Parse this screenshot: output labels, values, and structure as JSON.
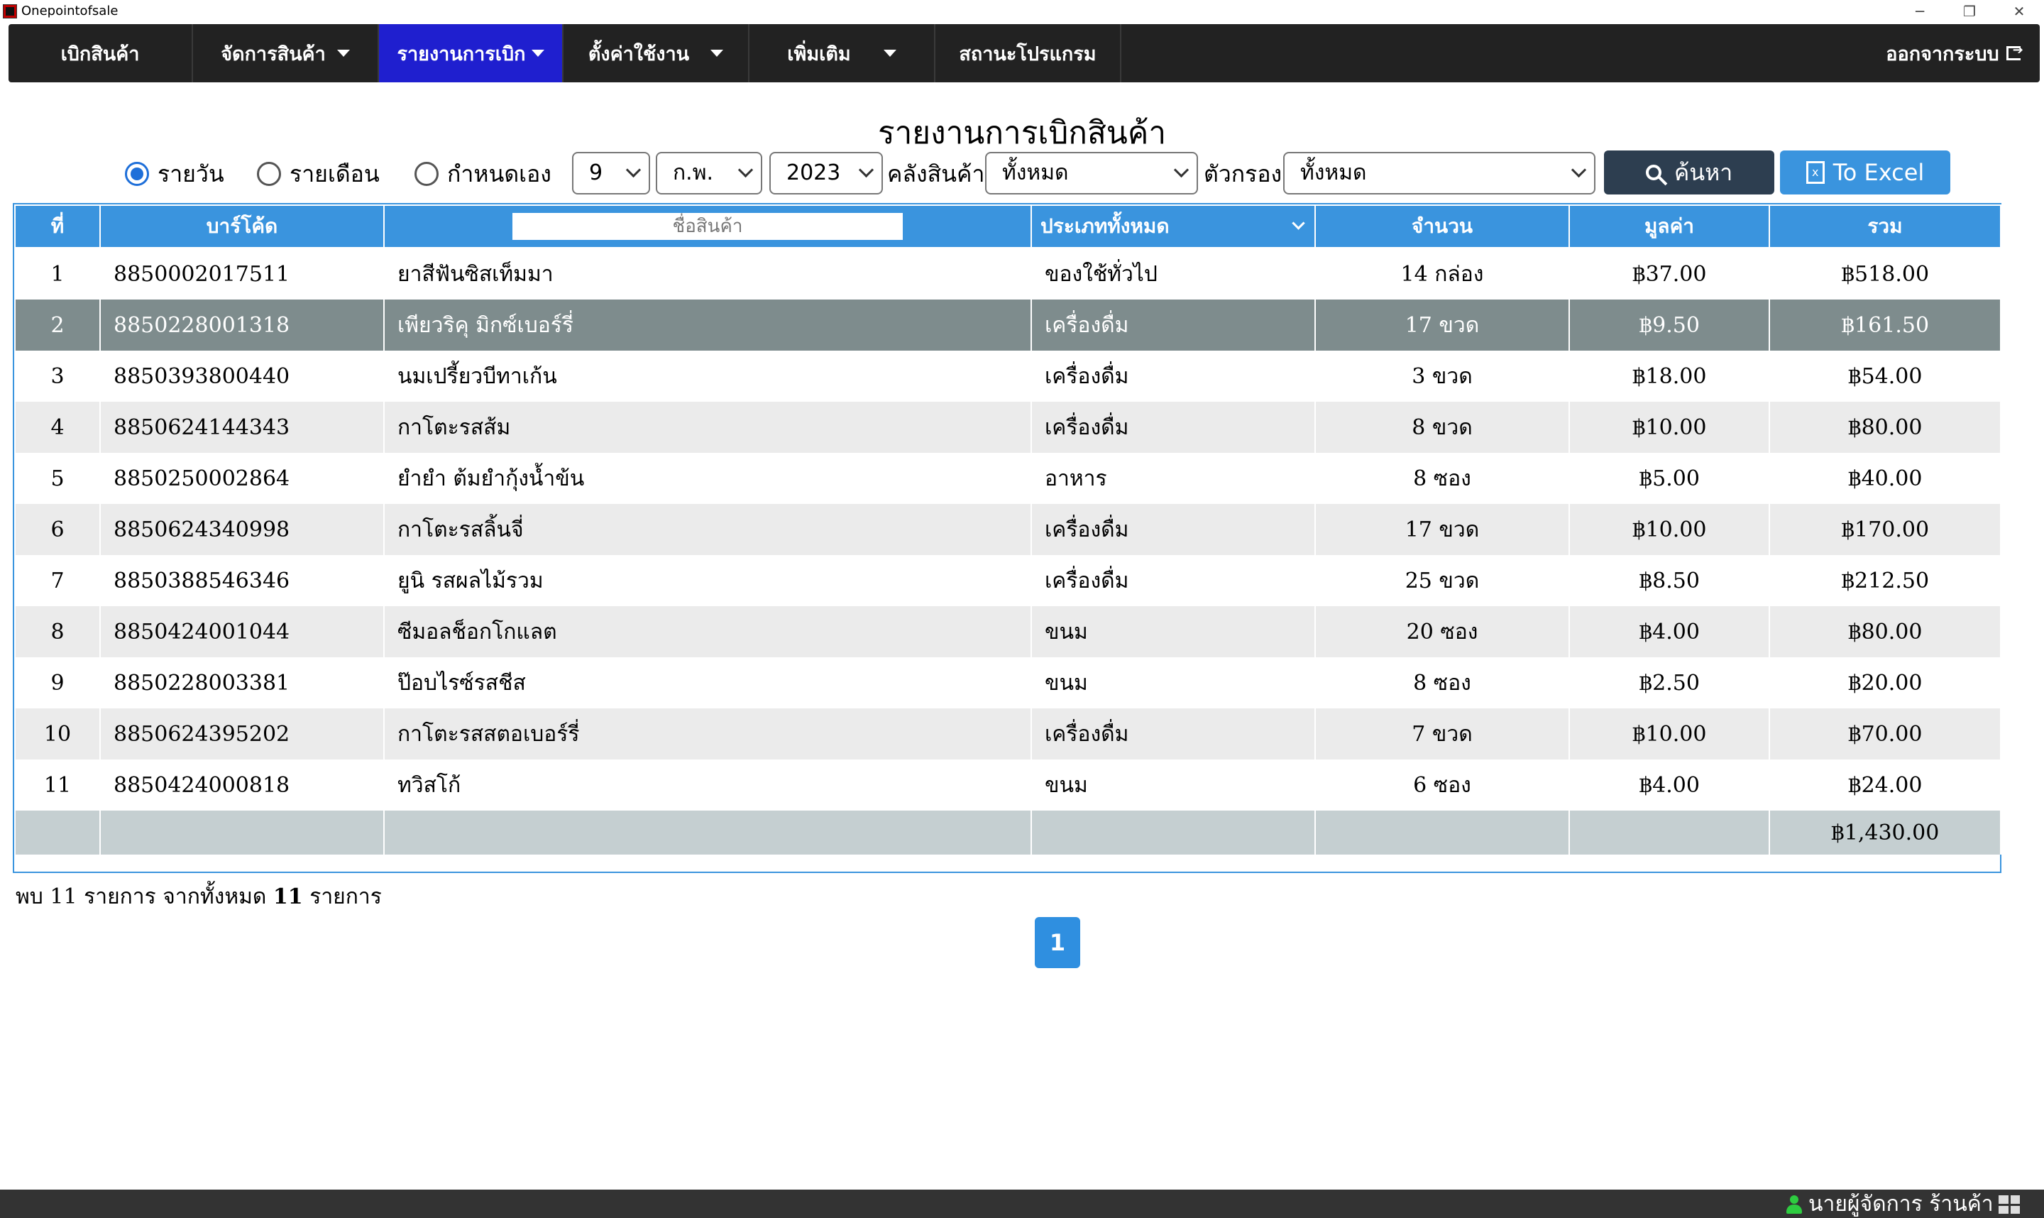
{
  "window": {
    "title": "Onepointofsale"
  },
  "nav": {
    "items": [
      {
        "label": "เบิกสินค้า",
        "dropdown": false,
        "active": false
      },
      {
        "label": "จัดการสินค้า",
        "dropdown": true,
        "active": false
      },
      {
        "label": "รายงานการเบิก",
        "dropdown": true,
        "active": true
      },
      {
        "label": "ตั้งค่าใช้งาน",
        "dropdown": true,
        "active": false
      },
      {
        "label": "เพิ่มเติม",
        "dropdown": true,
        "active": false
      },
      {
        "label": "สถานะโปรแกรม",
        "dropdown": false,
        "active": false
      }
    ],
    "logout_label": "ออกจากระบบ"
  },
  "report": {
    "title": "รายงานการเบิกสินค้า",
    "period_options": [
      "รายวัน",
      "รายเดือน",
      "กำหนดเอง"
    ],
    "period_selected": "รายวัน",
    "day": "9",
    "month": "ก.พ.",
    "year": "2023",
    "warehouse_label": "คลังสินค้า",
    "warehouse_value": "ทั้งหมด",
    "filter_label": "ตัวกรอง",
    "filter_value": "ทั้งหมด",
    "search_label": "ค้นหา",
    "excel_label": "To Excel"
  },
  "table": {
    "headers": {
      "no": "ที่",
      "barcode": "บาร์โค้ด",
      "name_placeholder": "ชื่อสินค้า",
      "category": "ประเภททั้งหมด",
      "qty": "จำนวน",
      "price": "มูลค่า",
      "total": "รวม"
    },
    "selected_row": 2,
    "rows": [
      {
        "no": "1",
        "barcode": "8850002017511",
        "name": "ยาสีฟันซิสเท็มมา",
        "category": "ของใช้ทั่วไป",
        "qty": "14 กล่อง",
        "price": "฿37.00",
        "total": "฿518.00"
      },
      {
        "no": "2",
        "barcode": "8850228001318",
        "name": "เพียวริคุ มิกซ์เบอร์รี่",
        "category": "เครื่องดื่ม",
        "qty": "17 ขวด",
        "price": "฿9.50",
        "total": "฿161.50"
      },
      {
        "no": "3",
        "barcode": "8850393800440",
        "name": "นมเปรี้ยวบีทาเก้น",
        "category": "เครื่องดื่ม",
        "qty": "3 ขวด",
        "price": "฿18.00",
        "total": "฿54.00"
      },
      {
        "no": "4",
        "barcode": "8850624144343",
        "name": "กาโตะรสส้ม",
        "category": "เครื่องดื่ม",
        "qty": "8 ขวด",
        "price": "฿10.00",
        "total": "฿80.00"
      },
      {
        "no": "5",
        "barcode": "8850250002864",
        "name": "ยำยำ ต้มยำกุ้งน้ำข้น",
        "category": "อาหาร",
        "qty": "8 ซอง",
        "price": "฿5.00",
        "total": "฿40.00"
      },
      {
        "no": "6",
        "barcode": "8850624340998",
        "name": "กาโตะรสลิ้นจี่",
        "category": "เครื่องดื่ม",
        "qty": "17 ขวด",
        "price": "฿10.00",
        "total": "฿170.00"
      },
      {
        "no": "7",
        "barcode": "8850388546346",
        "name": "ยูนิ รสผลไม้รวม",
        "category": "เครื่องดื่ม",
        "qty": "25 ขวด",
        "price": "฿8.50",
        "total": "฿212.50"
      },
      {
        "no": "8",
        "barcode": "8850424001044",
        "name": "ซีมอลช็อกโกแลต",
        "category": "ขนม",
        "qty": "20 ซอง",
        "price": "฿4.00",
        "total": "฿80.00"
      },
      {
        "no": "9",
        "barcode": "8850228003381",
        "name": "ป๊อบไรซ์รสชีส",
        "category": "ขนม",
        "qty": "8 ซอง",
        "price": "฿2.50",
        "total": "฿20.00"
      },
      {
        "no": "10",
        "barcode": "8850624395202",
        "name": "กาโตะรสสตอเบอร์รี่",
        "category": "เครื่องดื่ม",
        "qty": "7 ขวด",
        "price": "฿10.00",
        "total": "฿70.00"
      },
      {
        "no": "11",
        "barcode": "8850424000818",
        "name": "ทวิสโก้",
        "category": "ขนม",
        "qty": "6 ซอง",
        "price": "฿4.00",
        "total": "฿24.00"
      }
    ],
    "grand_total": "฿1,430.00"
  },
  "summary": {
    "prefix": "พบ",
    "found": "11",
    "middle": "รายการ จากทั้งหมด",
    "total": "11",
    "suffix": "รายการ"
  },
  "pagination": {
    "current": "1"
  },
  "status": {
    "user": "นายผู้จัดการ ร้านค้า"
  },
  "colors": {
    "accent": "#3a94de",
    "nav_bg": "#222222",
    "nav_active": "#1f1fcf",
    "row_selected": "#7e8c8d"
  }
}
